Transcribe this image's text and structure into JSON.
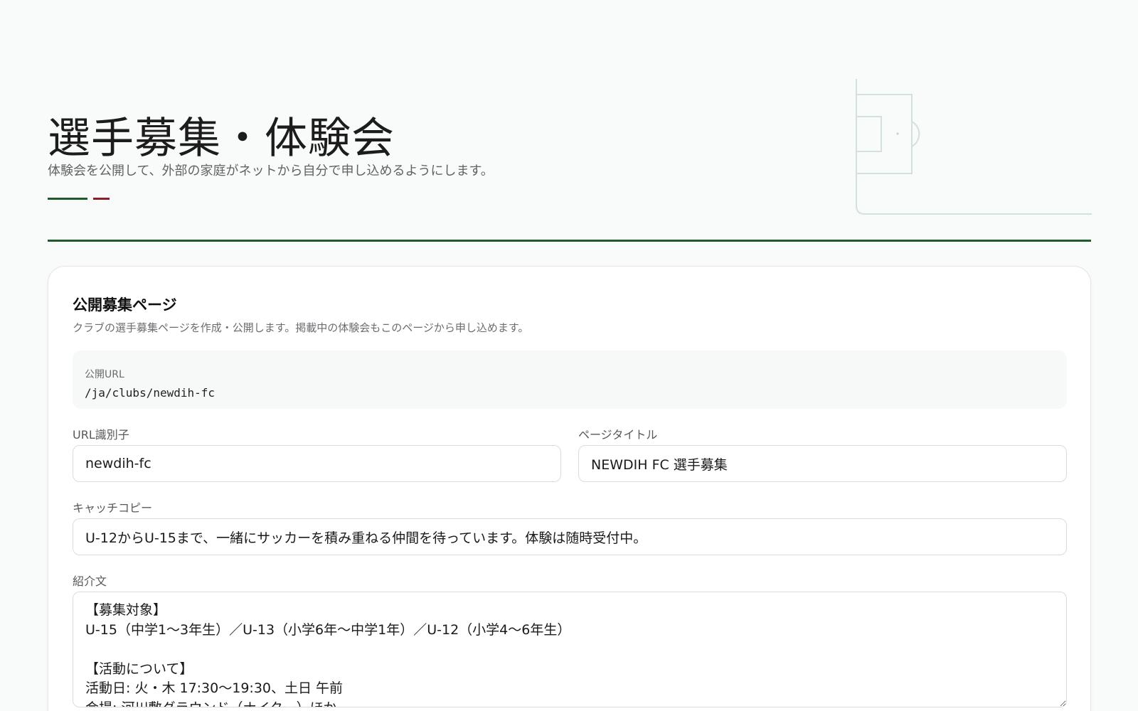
{
  "header": {
    "title": "選手募集・体験会",
    "subtitle": "体験会を公開して、外部の家庭がネットから自分で申し込めるようにします。"
  },
  "colors": {
    "brand_green": "#1f5a2a",
    "brand_red": "#8c1d2a"
  },
  "card": {
    "title": "公開募集ページ",
    "description": "クラブの選手募集ページを作成・公開します。掲載中の体験会もこのページから申し込めます。",
    "public_url": {
      "label": "公開URL",
      "value": "/ja/clubs/newdih-fc"
    },
    "slug": {
      "label": "URL識別子",
      "value": "newdih-fc"
    },
    "page_title": {
      "label": "ページタイトル",
      "value": "NEWDIH FC 選手募集"
    },
    "catchphrase": {
      "label": "キャッチコピー",
      "value": "U-12からU-15まで、一緒にサッカーを積み重ねる仲間を待っています。体験は随時受付中。"
    },
    "introduction": {
      "label": "紹介文",
      "value": "【募集対象】\nU-15（中学1〜3年生）／U-13（小学6年〜中学1年）／U-12（小学4〜6年生）\n\n【活動について】\n活動日: 火・木 17:30〜19:30、土日 午前\n会場: 河川敷グラウンド（ナイター）ほか"
    }
  }
}
